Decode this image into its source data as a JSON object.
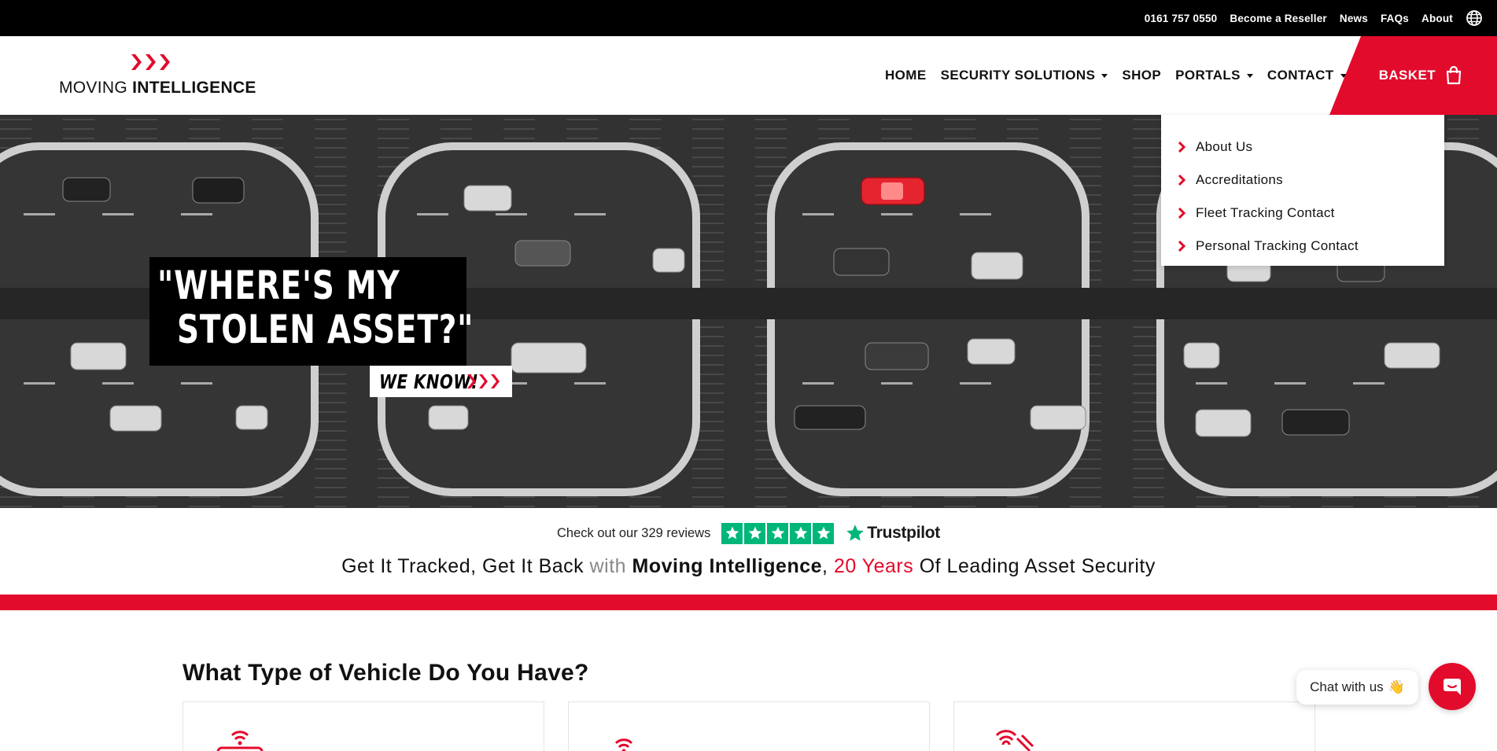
{
  "topbar": {
    "phone": "0161 757 0550",
    "reseller": "Become a Reseller",
    "news": "News",
    "faqs": "FAQs",
    "about": "About",
    "language_icon": "globe-icon"
  },
  "logo": {
    "text_regular": "MOVING",
    "text_bold": "INTELLIGENCE"
  },
  "nav": {
    "home": "HOME",
    "security": "SECURITY SOLUTIONS",
    "shop": "SHOP",
    "portals": "PORTALS",
    "contact": "CONTACT",
    "basket": "BASKET"
  },
  "dropdown": {
    "items": [
      {
        "label": "About Us"
      },
      {
        "label": "Accreditations"
      },
      {
        "label": "Fleet Tracking Contact"
      },
      {
        "label": "Personal Tracking Contact"
      }
    ]
  },
  "hero": {
    "headline_line1": "\"WHERE'S MY",
    "headline_line2": "STOLEN ASSET?\"",
    "subline": "WE KNOW!"
  },
  "trustpilot": {
    "text": "Check out our 329 reviews",
    "brand": "Trustpilot",
    "rating_stars": 5
  },
  "tagline": {
    "part1": "Get It Tracked, Get It Back ",
    "with": "with",
    "brand": "Moving Intelligence",
    "comma": ", ",
    "years": "20 Years",
    "rest": " Of Leading Asset Security"
  },
  "section": {
    "title": "What Type of Vehicle Do You Have?"
  },
  "chat": {
    "label": "Chat with us",
    "emoji": "👋"
  },
  "colors": {
    "brand_red": "#e30b2b",
    "trustpilot_green": "#00b67a"
  }
}
